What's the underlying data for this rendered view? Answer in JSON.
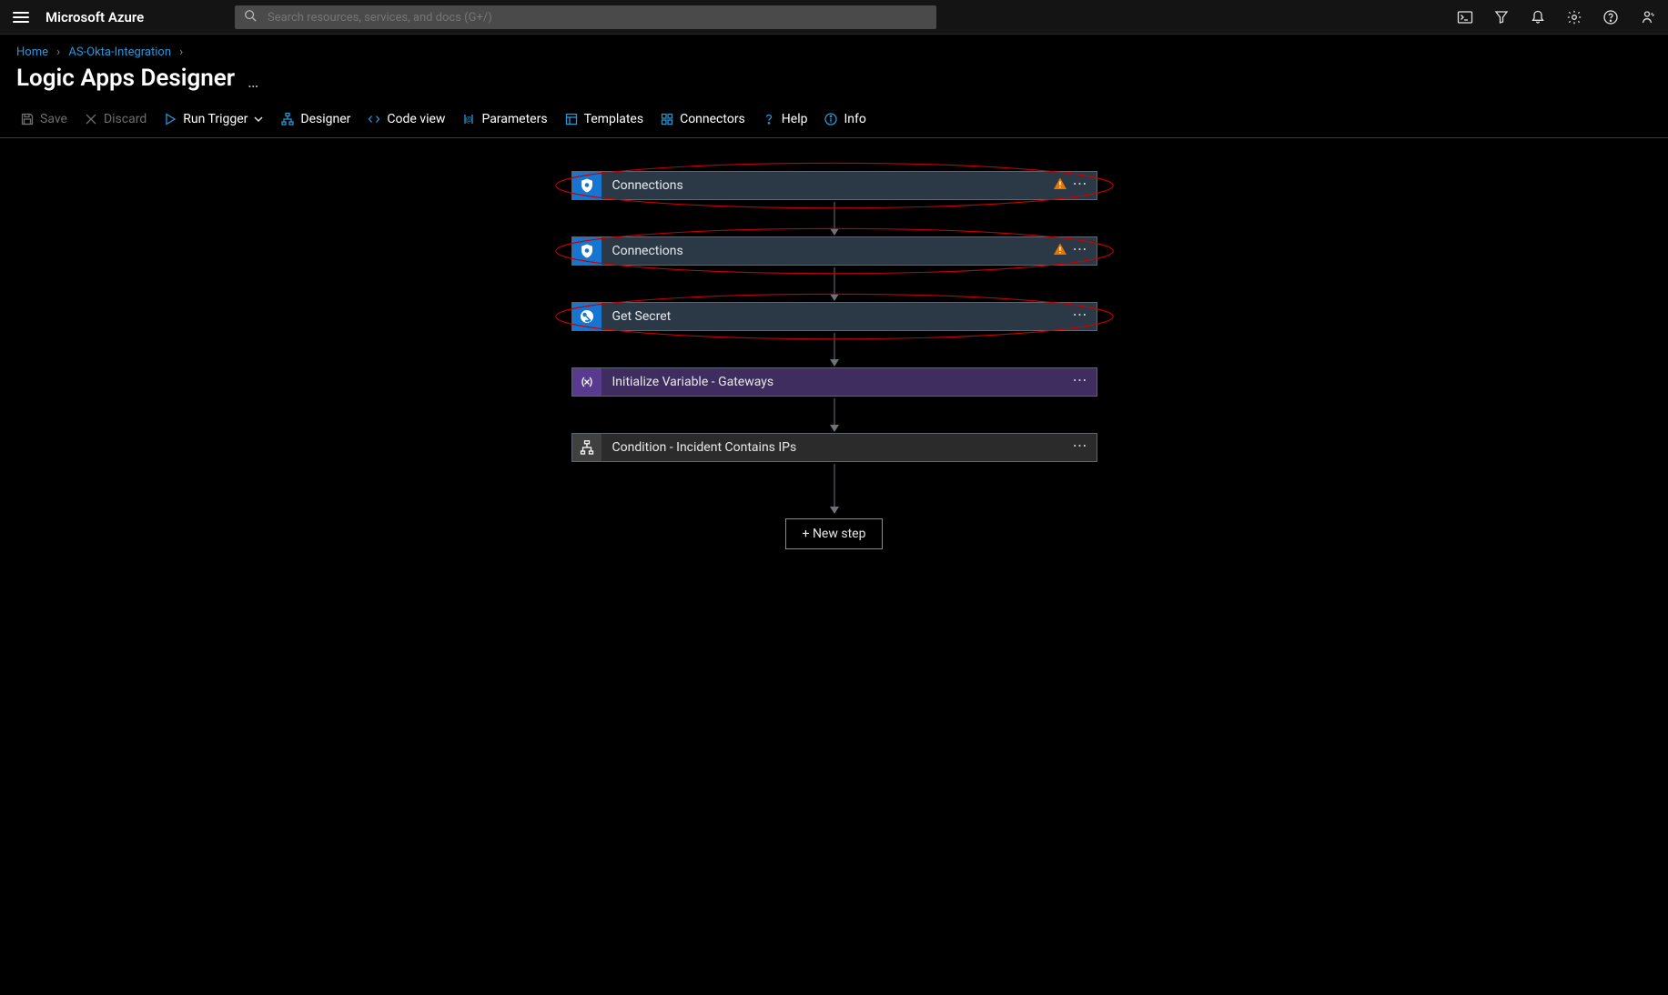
{
  "header": {
    "brand": "Microsoft Azure",
    "search_placeholder": "Search resources, services, and docs (G+/)"
  },
  "breadcrumbs": {
    "home": "Home",
    "parent": "AS-Okta-Integration"
  },
  "page_title": "Logic Apps Designer",
  "commands": {
    "save": "Save",
    "discard": "Discard",
    "run_trigger": "Run Trigger",
    "designer": "Designer",
    "code_view": "Code view",
    "parameters": "Parameters",
    "templates": "Templates",
    "connectors": "Connectors",
    "help": "Help",
    "info": "Info"
  },
  "workflow": {
    "steps": [
      {
        "label": "Connections",
        "kind": "sentinel",
        "warn": true,
        "annotated": true
      },
      {
        "label": "Connections",
        "kind": "sentinel",
        "warn": true,
        "annotated": true
      },
      {
        "label": "Get Secret",
        "kind": "kv",
        "warn": false,
        "annotated": true
      },
      {
        "label": "Initialize Variable - Gateways",
        "kind": "var",
        "warn": false,
        "annotated": false
      },
      {
        "label": "Condition - Incident Contains IPs",
        "kind": "cond",
        "warn": false,
        "annotated": false
      }
    ],
    "new_step": "+ New step"
  }
}
